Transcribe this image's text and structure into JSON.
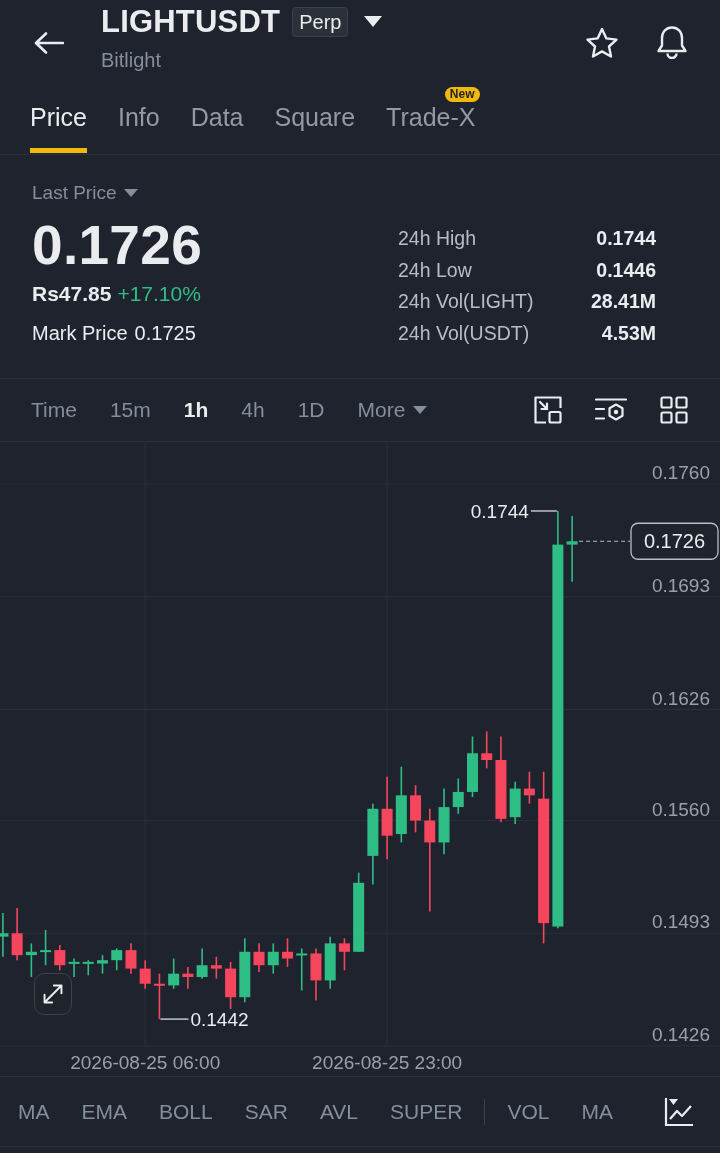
{
  "header": {
    "title": "LIGHTUSDT",
    "badge": "Perp",
    "subtitle": "Bitlight"
  },
  "tabs": [
    {
      "label": "Price",
      "selected": true
    },
    {
      "label": "Info",
      "selected": false
    },
    {
      "label": "Data",
      "selected": false
    },
    {
      "label": "Square",
      "selected": false
    },
    {
      "label": "Trade-X",
      "selected": false,
      "badge": "New"
    }
  ],
  "price_panel": {
    "price_type": "Last Price",
    "last_price": "0.1726",
    "fiat_price": "Rs47.85",
    "change": "+17.10%",
    "mark_price_label": "Mark Price",
    "mark_price": "0.1725",
    "stats": [
      {
        "label": "24h High",
        "value": "0.1744"
      },
      {
        "label": "24h Low",
        "value": "0.1446"
      },
      {
        "label": "24h Vol(LIGHT)",
        "value": "28.41M"
      },
      {
        "label": "24h Vol(USDT)",
        "value": "4.53M"
      }
    ]
  },
  "intervals": [
    {
      "kind": "option",
      "label": "Time",
      "selected": false
    },
    {
      "kind": "option",
      "label": "15m",
      "selected": false
    },
    {
      "kind": "option",
      "label": "1h",
      "selected": true
    },
    {
      "kind": "option",
      "label": "4h",
      "selected": false
    },
    {
      "kind": "option",
      "label": "1D",
      "selected": false
    },
    {
      "kind": "dropdown",
      "label": "More",
      "selected": false
    }
  ],
  "chart": {
    "chart_data": {
      "type": "candlestick",
      "categories": [
        null,
        null,
        null,
        null,
        null,
        null,
        null,
        null,
        null,
        null,
        "2026-08-25 06:00",
        null,
        null,
        null,
        null,
        null,
        null,
        null,
        null,
        null,
        null,
        null,
        null,
        null,
        null,
        null,
        null,
        "2026-08-25 23:00",
        null,
        null,
        null,
        null,
        null,
        null,
        null,
        null,
        null,
        null,
        null,
        null,
        null
      ],
      "ohlc": [
        [
          0.1491,
          0.1505,
          0.1479,
          0.1493
        ],
        [
          0.1493,
          0.1508,
          0.1477,
          0.148
        ],
        [
          0.148,
          0.1487,
          0.1467,
          0.1482
        ],
        [
          0.1482,
          0.1495,
          0.1474,
          0.1483
        ],
        [
          0.1483,
          0.1486,
          0.1471,
          0.1474
        ],
        [
          0.1475,
          0.1478,
          0.1467,
          0.1476
        ],
        [
          0.1475,
          0.1477,
          0.1468,
          0.1476
        ],
        [
          0.1475,
          0.148,
          0.1469,
          0.1477
        ],
        [
          0.1477,
          0.1484,
          0.1471,
          0.1483
        ],
        [
          0.1483,
          0.1487,
          0.1469,
          0.1472
        ],
        [
          0.1472,
          0.1477,
          0.146,
          0.1463
        ],
        [
          0.1463,
          0.1469,
          0.1442,
          0.1462
        ],
        [
          0.1462,
          0.1478,
          0.146,
          0.1469
        ],
        [
          0.1469,
          0.1473,
          0.146,
          0.1467
        ],
        [
          0.1467,
          0.1484,
          0.1466,
          0.1474
        ],
        [
          0.1474,
          0.1479,
          0.1466,
          0.1472
        ],
        [
          0.1472,
          0.1476,
          0.1448,
          0.1455
        ],
        [
          0.1455,
          0.149,
          0.1452,
          0.1482
        ],
        [
          0.1482,
          0.1487,
          0.147,
          0.1474
        ],
        [
          0.1474,
          0.1487,
          0.1469,
          0.1482
        ],
        [
          0.1482,
          0.149,
          0.1473,
          0.1478
        ],
        [
          0.148,
          0.1484,
          0.1459,
          0.1481
        ],
        [
          0.1481,
          0.1484,
          0.1453,
          0.1465
        ],
        [
          0.1465,
          0.1491,
          0.146,
          0.1487
        ],
        [
          0.1487,
          0.149,
          0.1471,
          0.1482
        ],
        [
          0.1482,
          0.1529,
          0.1482,
          0.1523
        ],
        [
          0.1539,
          0.157,
          0.1522,
          0.1567
        ],
        [
          0.1567,
          0.1586,
          0.1537,
          0.1551
        ],
        [
          0.1552,
          0.1592,
          0.1547,
          0.1575
        ],
        [
          0.1575,
          0.1581,
          0.1553,
          0.156
        ],
        [
          0.156,
          0.1567,
          0.1506,
          0.1547
        ],
        [
          0.1547,
          0.1579,
          0.154,
          0.1568
        ],
        [
          0.1568,
          0.1585,
          0.1564,
          0.1577
        ],
        [
          0.1577,
          0.161,
          0.1574,
          0.16
        ],
        [
          0.16,
          0.1613,
          0.1591,
          0.1596
        ],
        [
          0.1596,
          0.161,
          0.1559,
          0.1561
        ],
        [
          0.1562,
          0.1583,
          0.1558,
          0.1579
        ],
        [
          0.1579,
          0.1589,
          0.157,
          0.1575
        ],
        [
          0.1573,
          0.1589,
          0.1487,
          0.1499
        ],
        [
          0.1497,
          0.1744,
          0.1496,
          0.1724
        ],
        [
          0.1724,
          0.1741,
          0.1702,
          0.1726
        ]
      ],
      "ylim": [
        0.1426,
        0.1785
      ],
      "grid": true,
      "yticks": [
        {
          "value": 0.176,
          "label": "0.1760"
        },
        {
          "value": 0.1693,
          "label": "0.1693"
        },
        {
          "value": 0.1626,
          "label": "0.1626"
        },
        {
          "value": 0.156,
          "label": "0.1560"
        },
        {
          "value": 0.1493,
          "label": "0.1493"
        },
        {
          "value": 0.1426,
          "label": "0.1426"
        }
      ],
      "annotations": [
        "0.1744",
        "0.1442"
      ]
    },
    "last_price_tag": "0.1726"
  },
  "main_indicators": [
    "MA",
    "EMA",
    "BOLL",
    "SAR",
    "AVL",
    "SUPER"
  ],
  "sub_indicators": [
    "VOL",
    "MA"
  ]
}
